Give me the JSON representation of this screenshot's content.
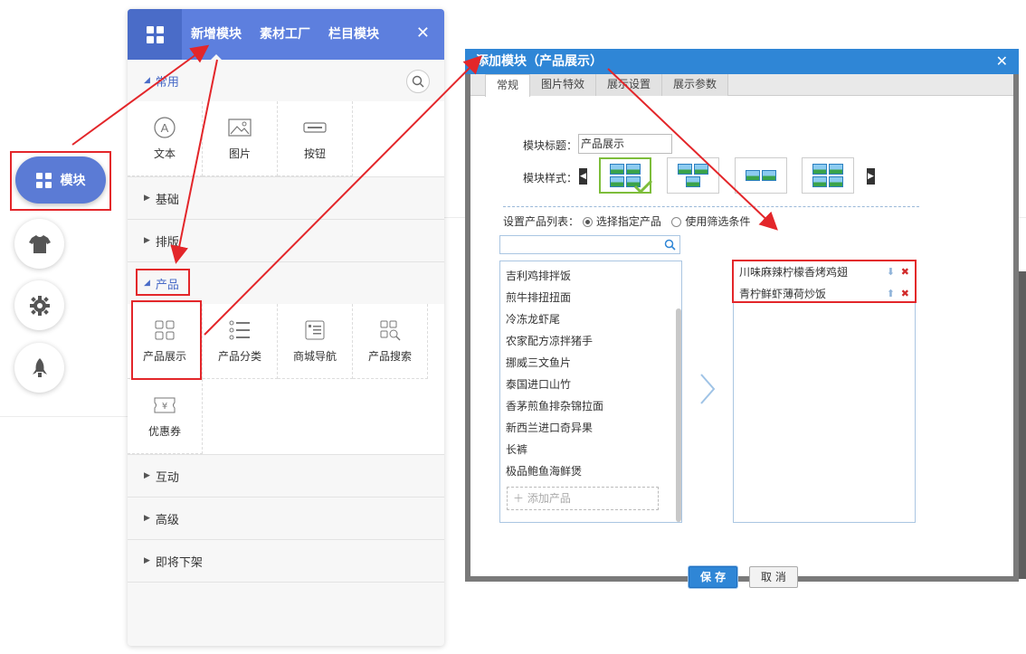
{
  "dock": {
    "main_label": "模块"
  },
  "panel": {
    "tabs": [
      "新增模块",
      "素材工厂",
      "栏目模块"
    ],
    "sections": {
      "common": {
        "title": "常用",
        "items": [
          "文本",
          "图片",
          "按钮"
        ]
      },
      "basic": {
        "title": "基础"
      },
      "layout": {
        "title": "排版"
      },
      "product": {
        "title": "产品",
        "items": [
          "产品展示",
          "产品分类",
          "商城导航",
          "产品搜索",
          "优惠券"
        ]
      },
      "interact": {
        "title": "互动"
      },
      "advanced": {
        "title": "高级"
      },
      "retiring": {
        "title": "即将下架"
      }
    }
  },
  "dialog": {
    "title": "添加模块（产品展示）",
    "tabs": [
      "常规",
      "图片特效",
      "展示设置",
      "展示参数"
    ],
    "module_title_label": "模块标题：",
    "module_title_value": "产品展示",
    "module_style_label": "模块样式：",
    "product_list_label": "设置产品列表：",
    "radio_specific": "选择指定产品",
    "radio_filter": "使用筛选条件",
    "search_placeholder": "",
    "products": [
      "吉利鸡排拌饭",
      "煎牛排扭扭面",
      "冷冻龙虾尾",
      "农家配方凉拌猪手",
      "挪威三文鱼片",
      "泰国进口山竹",
      "香茅煎鱼排杂锦拉面",
      "新西兰进口奇异果",
      "长裤",
      "极品鲍鱼海鲜煲"
    ],
    "add_product": "添加产品",
    "selected": [
      "川味麻辣柠檬香烤鸡翅",
      "青柠鲜虾薄荷炒饭"
    ],
    "save": "保 存",
    "cancel": "取 消"
  },
  "colors": {
    "accent_blue": "#5d7fde",
    "dialog_title": "#2f86d6",
    "annotation_red": "#e3262a"
  }
}
